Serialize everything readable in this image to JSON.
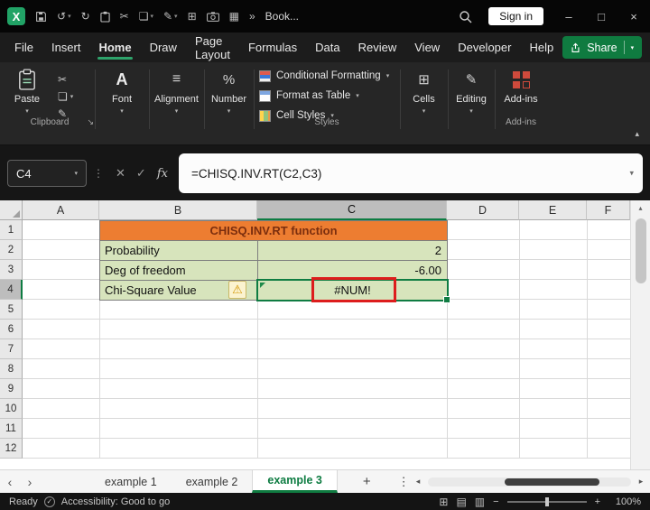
{
  "titlebar": {
    "app_letter": "X",
    "workbook_title": "Book...",
    "sign_in_label": "Sign in"
  },
  "menubar": {
    "items": [
      "File",
      "Insert",
      "Home",
      "Draw",
      "Page Layout",
      "Formulas",
      "Data",
      "Review",
      "View",
      "Developer",
      "Help"
    ],
    "active_item": "Home",
    "share_label": "Share"
  },
  "ribbon": {
    "paste_label": "Paste",
    "font_label": "Font",
    "alignment_label": "Alignment",
    "number_label": "Number",
    "conditional_formatting_label": "Conditional Formatting",
    "format_as_table_label": "Format as Table",
    "cell_styles_label": "Cell Styles",
    "cells_label": "Cells",
    "editing_label": "Editing",
    "addins_label": "Add-ins",
    "group_labels": {
      "clipboard": "Clipboard",
      "styles": "Styles",
      "addins": "Add-ins"
    }
  },
  "formula_bar": {
    "name_box": "C4",
    "formula": "=CHISQ.INV.RT(C2,C3)",
    "fx_label": "fx"
  },
  "grid": {
    "columns": [
      "A",
      "B",
      "C",
      "D",
      "E",
      "F"
    ],
    "rows": [
      "1",
      "2",
      "3",
      "4",
      "5",
      "6",
      "7",
      "8",
      "9",
      "10",
      "11",
      "12"
    ],
    "selected_cell": "C4",
    "cells": {
      "title": "CHISQ.INV.RT function",
      "b2": "Probability",
      "c2": "2",
      "b3": "Deg of freedom",
      "c3": "-6.00",
      "b4": "Chi-Square Value",
      "c4": "#NUM!"
    }
  },
  "sheet_tabs": {
    "tabs": [
      "example 1",
      "example 2",
      "example 3"
    ],
    "active_tab": "example 3",
    "add_label": "+",
    "more_label": "⋮"
  },
  "status_bar": {
    "ready": "Ready",
    "accessibility": "Accessibility: Good to go",
    "zoom_out": "−",
    "zoom_in": "+",
    "zoom_level": "100%"
  },
  "icons": {
    "caret_down": "▾",
    "caret_up": "▴",
    "undo": "↺",
    "redo": "↻",
    "cut": "✂",
    "copy": "❏",
    "pen": "✎",
    "table": "⊞",
    "borders": "▦",
    "overflow": "»",
    "minimize": "–",
    "maximize": "□",
    "close": "×",
    "dots_vertical": "⋮",
    "cancel": "✕",
    "check": "✓",
    "align": "≡",
    "percent": "%",
    "font_a": "A",
    "editing": "✎",
    "cells": "⊞",
    "warning": "⚠",
    "launcher": "↘",
    "tab_prev": "‹",
    "tab_next": "›",
    "scroll_left": "◂",
    "scroll_right": "▸",
    "scroll_up": "▴",
    "view_normal": "⊞",
    "view_layout": "▤",
    "view_break": "▥",
    "accessibility_check": "✓"
  },
  "colors": {
    "accent_green": "#107C41",
    "title_fill_orange": "#ED7D31",
    "title_text": "#7B2E0E",
    "data_fill_green": "#D7E4BC",
    "annotation_red": "#DD1D1D",
    "addins_red": "#CF4A3C"
  }
}
